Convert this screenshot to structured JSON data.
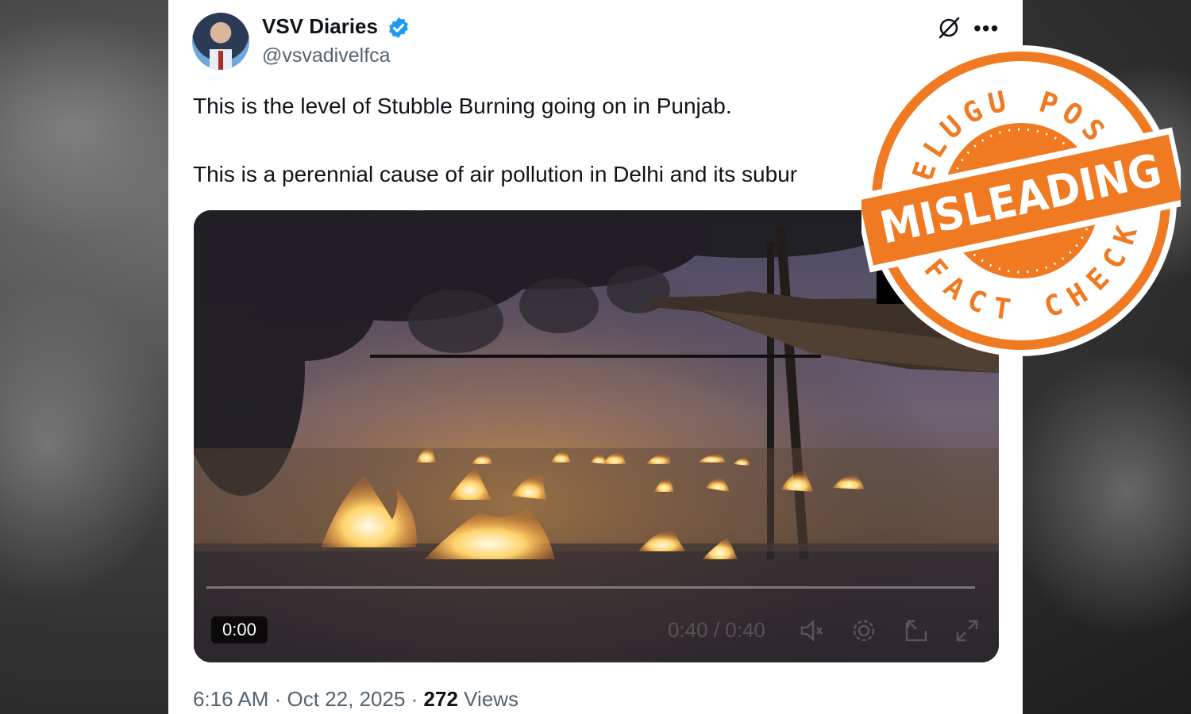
{
  "post": {
    "author_name": "VSV Diaries",
    "author_handle": "@vsvadivelfca",
    "text_line1": "This is the level of Stubble Burning going on in Punjab.",
    "text_line2": "This is a perennial cause of air pollution in Delhi and its subur",
    "time": "6:16 AM",
    "date": "Oct 22, 2025",
    "views_count": "272",
    "views_label": "Views"
  },
  "video": {
    "current_time": "0:00",
    "duration": "0:40 / 0:40",
    "progress_fraction": 0.0
  },
  "stamp": {
    "top_text": "TELUGU POST",
    "banner_text": "MISLEADING",
    "bottom_text": "FACT CHECK",
    "color": "#f07a22"
  },
  "colors": {
    "verified": "#1d9bf0",
    "text": "#0f1419",
    "muted": "#536471"
  },
  "icons": {
    "verified": "verified-badge-icon",
    "grok": "grok-icon",
    "more": "more-icon",
    "mute": "mute-icon",
    "settings": "gear-icon",
    "pip": "picture-in-picture-icon",
    "fullscreen": "fullscreen-icon"
  }
}
